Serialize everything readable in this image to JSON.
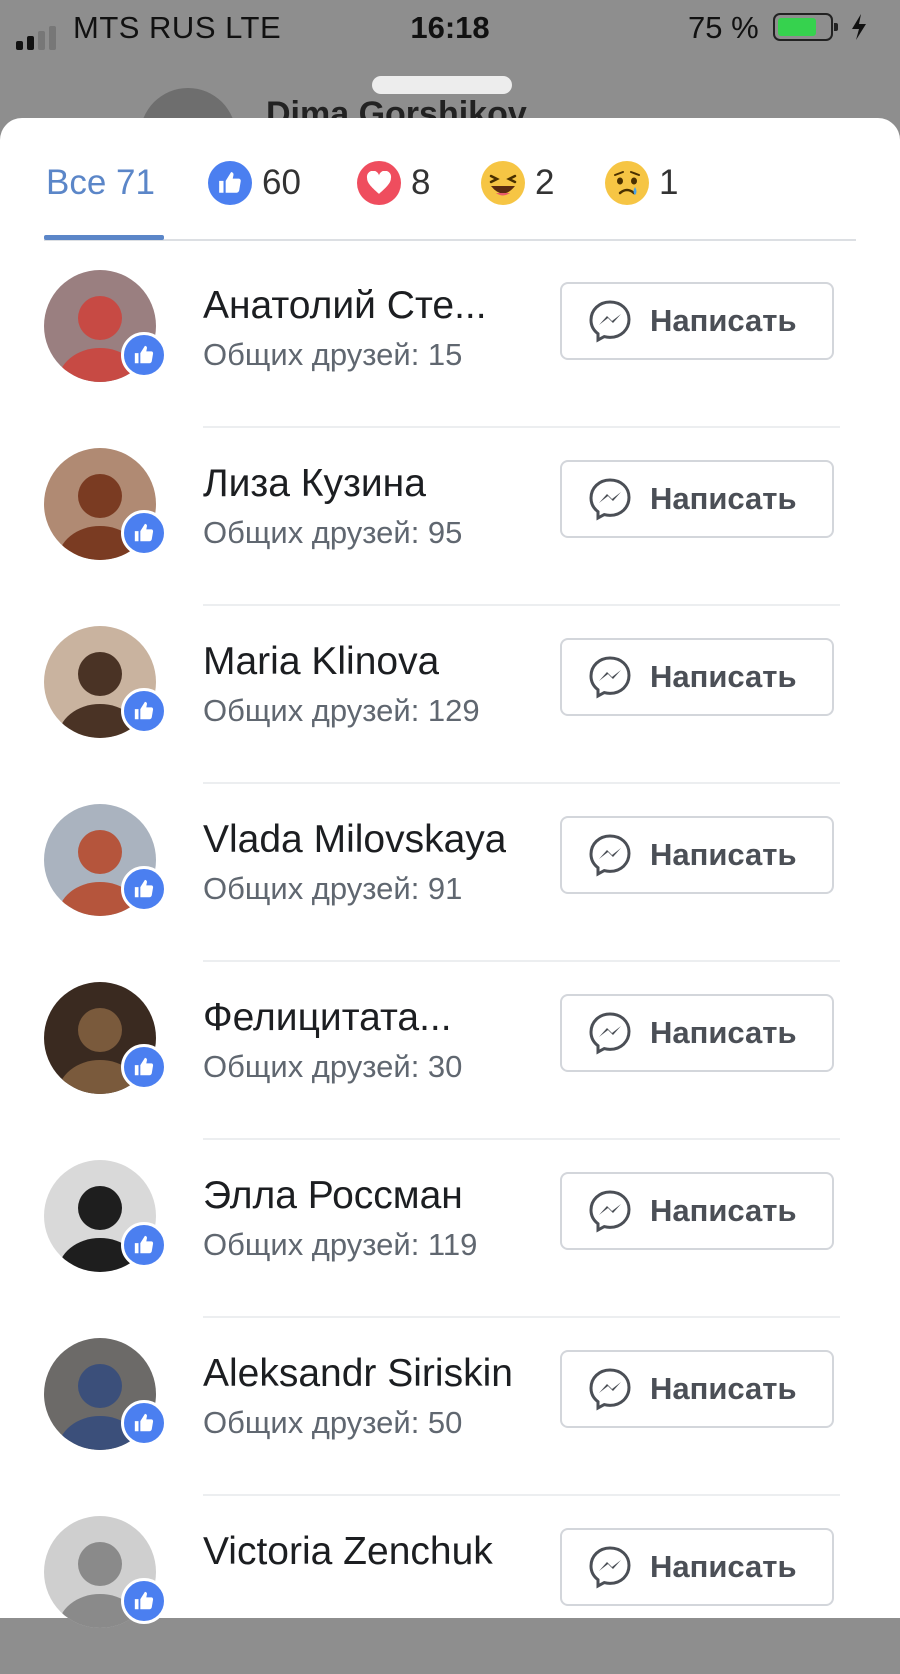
{
  "status_bar": {
    "carrier": "MTS RUS   LTE",
    "time": "16:18",
    "battery": "75 %",
    "battery_level": 0.75
  },
  "background_post": {
    "author": "Dima Gorshikov"
  },
  "reaction_tabs": [
    {
      "label": "Все 71",
      "icon": "all"
    },
    {
      "count": "60",
      "icon": "like-reaction-icon"
    },
    {
      "count": "8",
      "icon": "love-reaction-icon"
    },
    {
      "count": "2",
      "icon": "haha-reaction-icon"
    },
    {
      "count": "1",
      "icon": "sad-reaction-icon"
    }
  ],
  "people": [
    {
      "name": "Анатолий Сте...",
      "mutual": "Общих друзей: 15",
      "button": "Написать",
      "avatar_color": "#9a7f80",
      "avatar_accent": "#c74a44"
    },
    {
      "name": "Лиза Кузина",
      "mutual": "Общих друзей: 95",
      "button": "Написать",
      "avatar_color": "#b08a73",
      "avatar_accent": "#7a3b22"
    },
    {
      "name": "Maria Klinova",
      "mutual": "Общих друзей: 129",
      "button": "Написать",
      "avatar_color": "#c9b39f",
      "avatar_accent": "#4a3325"
    },
    {
      "name": "Vlada Milovskaya",
      "mutual": "Общих друзей: 91",
      "button": "Написать",
      "avatar_color": "#aab3bf",
      "avatar_accent": "#b5553c"
    },
    {
      "name": "Фелицитата...",
      "mutual": "Общих друзей: 30",
      "button": "Написать",
      "avatar_color": "#3a2a20",
      "avatar_accent": "#7a5a3c"
    },
    {
      "name": "Элла Россман",
      "mutual": "Общих друзей: 119",
      "button": "Написать",
      "avatar_color": "#d9d9d9",
      "avatar_accent": "#1e1e1e"
    },
    {
      "name": "Aleksandr Siriskin",
      "mutual": "Общих друзей: 50",
      "button": "Написать",
      "avatar_color": "#6c6a68",
      "avatar_accent": "#3b4f7a"
    },
    {
      "name": "Victoria  Zenchuk",
      "mutual": "",
      "button": "Написать",
      "avatar_color": "#cfcfcf",
      "avatar_accent": "#8a8a8a"
    }
  ],
  "colors": {
    "accent": "#5b86c8",
    "like": "#4b7ff0",
    "love": "#ef4d5e",
    "emoji": "#f6c544"
  }
}
